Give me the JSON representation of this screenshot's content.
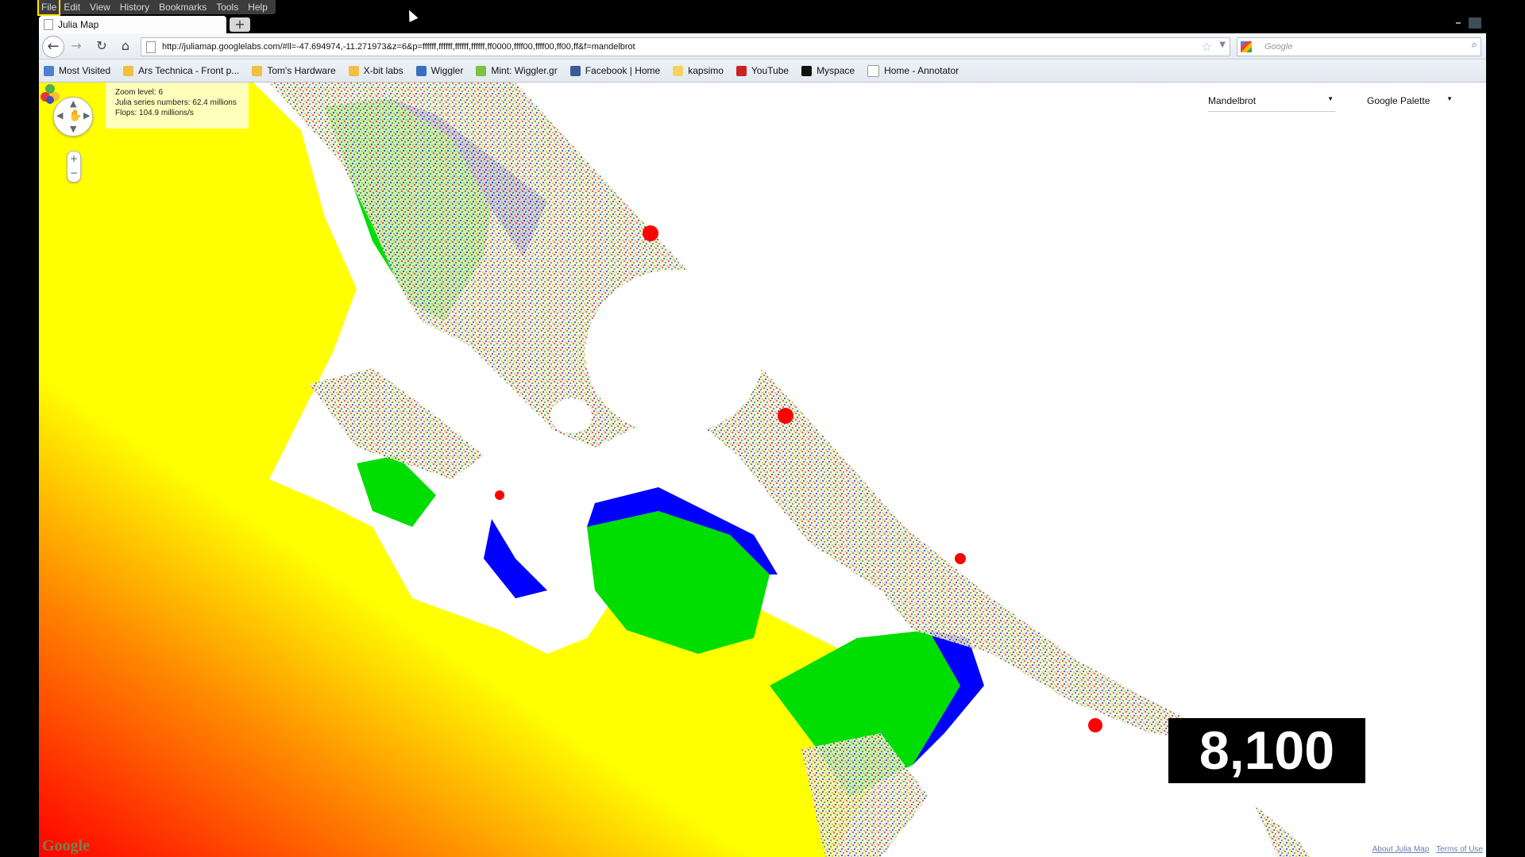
{
  "menu": [
    "File",
    "Edit",
    "View",
    "History",
    "Bookmarks",
    "Tools",
    "Help"
  ],
  "tab": {
    "title": "Julia Map",
    "new_tab": "+"
  },
  "nav": {
    "url": "http://juliamap.googlelabs.com/#ll=-47.694974,-11.271973&z=6&p=ffffff,ffffff,ffffff,ffffff,ff0000,ffff00,ffff00,ff00,ff&f=mandelbrot",
    "search_placeholder": "Google"
  },
  "bookmarks": [
    {
      "label": "Most Visited",
      "color": "#4f7fd0"
    },
    {
      "label": "Ars Technica - Front p...",
      "color": "#f0c040"
    },
    {
      "label": "Tom's Hardware",
      "color": "#f0c040"
    },
    {
      "label": "X-bit labs",
      "color": "#f0c040"
    },
    {
      "label": "Wiggler",
      "color": "#3a6fc0"
    },
    {
      "label": "Mint: Wiggler.gr",
      "color": "#7bc142"
    },
    {
      "label": "Facebook | Home",
      "color": "#3b5998"
    },
    {
      "label": "kapsimo",
      "color": "#f3d35e"
    },
    {
      "label": "YouTube",
      "color": "#cc2222"
    },
    {
      "label": "Myspace",
      "color": "#111111"
    },
    {
      "label": "Home - Annotator",
      "color": "#ffffff"
    }
  ],
  "map": {
    "info": {
      "zoom": "Zoom level: 6",
      "julia": "Julia series numbers: 62.4 millions",
      "flops": "Flops: 104.9 millions/s"
    },
    "fractal_select": "Mandelbrot",
    "palette_select": "Google Palette",
    "counter": "8,100",
    "footer": {
      "about": "About Julia Map",
      "terms": "Terms of Use"
    },
    "logo": "Google"
  },
  "colors": {
    "red": "#ff0000",
    "yellow": "#ffff00",
    "green": "#00ee00",
    "blue": "#0000ff",
    "background": "#ffffff"
  }
}
